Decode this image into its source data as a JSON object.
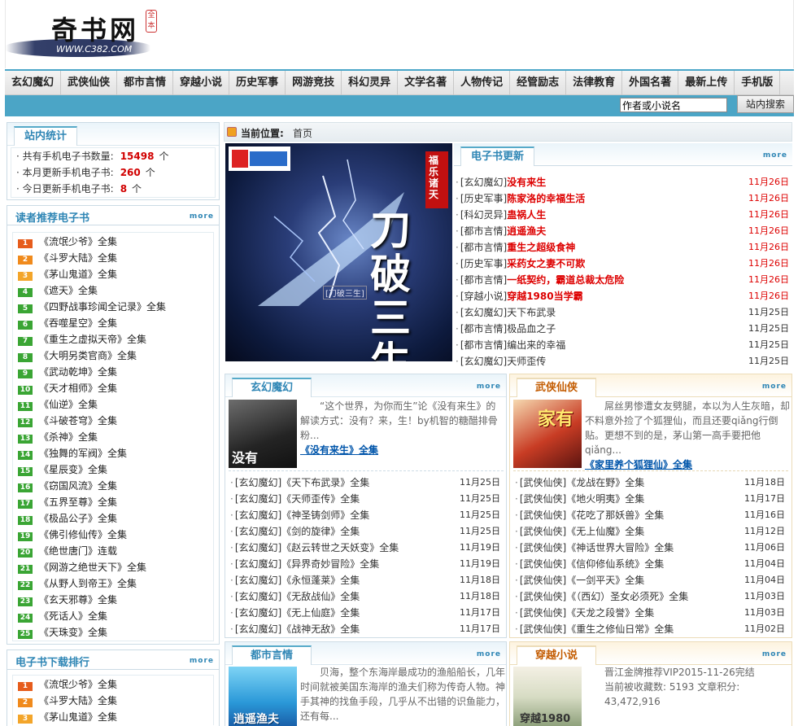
{
  "header": {
    "logo_text": "奇书网",
    "logo_url": "WWW.C382.COM",
    "logo_seal": "全本"
  },
  "nav": [
    "玄幻魔幻",
    "武侠仙侠",
    "都市言情",
    "穿越小说",
    "历史军事",
    "网游竞技",
    "科幻灵异",
    "文学名著",
    "人物传记",
    "经管励志",
    "法律教育",
    "外国名著",
    "最新上传",
    "手机版"
  ],
  "search": {
    "placeholder": "作者或小说名",
    "value": "作者或小说名",
    "button": "站内搜索"
  },
  "more_label": "more",
  "stats": {
    "title": "站内统计",
    "rows": [
      {
        "label": "共有手机电子书数量:",
        "value": "15498",
        "unit": "个"
      },
      {
        "label": "本月更新手机电子书:",
        "value": "260",
        "unit": "个"
      },
      {
        "label": "今日更新手机电子书:",
        "value": "8",
        "unit": "个"
      }
    ]
  },
  "reader_rank": {
    "title": "读者推荐电子书",
    "items": [
      {
        "n": "1",
        "t": "《流氓少爷》全集"
      },
      {
        "n": "2",
        "t": "《斗罗大陆》全集"
      },
      {
        "n": "3",
        "t": "《茅山鬼道》全集"
      },
      {
        "n": "4",
        "t": "《遮天》全集"
      },
      {
        "n": "5",
        "t": "《四野战事珍闻全记录》全集"
      },
      {
        "n": "6",
        "t": "《吞噬星空》全集"
      },
      {
        "n": "7",
        "t": "《重生之虚拟天帝》全集"
      },
      {
        "n": "8",
        "t": "《大明另类官商》全集"
      },
      {
        "n": "9",
        "t": "《武动乾坤》全集"
      },
      {
        "n": "10",
        "t": "《天才相师》全集"
      },
      {
        "n": "11",
        "t": "《仙逆》全集"
      },
      {
        "n": "12",
        "t": "《斗破苍穹》全集"
      },
      {
        "n": "13",
        "t": "《杀神》全集"
      },
      {
        "n": "14",
        "t": "《独舞的军阀》全集"
      },
      {
        "n": "15",
        "t": "《星辰变》全集"
      },
      {
        "n": "16",
        "t": "《窃国风流》全集"
      },
      {
        "n": "17",
        "t": "《五界至尊》全集"
      },
      {
        "n": "18",
        "t": "《极品公子》全集"
      },
      {
        "n": "19",
        "t": "《佛引修仙传》全集"
      },
      {
        "n": "20",
        "t": "《绝世唐门》连载"
      },
      {
        "n": "21",
        "t": "《网游之绝世天下》全集"
      },
      {
        "n": "22",
        "t": "《从野人到帝王》全集"
      },
      {
        "n": "23",
        "t": "《玄天邪尊》全集"
      },
      {
        "n": "24",
        "t": "《死话人》全集"
      },
      {
        "n": "25",
        "t": "《天珠变》全集"
      }
    ]
  },
  "download_rank": {
    "title": "电子书下载排行",
    "items": [
      {
        "n": "1",
        "t": "《流氓少爷》全集"
      },
      {
        "n": "2",
        "t": "《斗罗大陆》全集"
      },
      {
        "n": "3",
        "t": "《茅山鬼道》全集"
      }
    ]
  },
  "location": {
    "label": "当前位置:",
    "value": "首页"
  },
  "banner": {
    "title": "刀破三生",
    "top_tag": "福乐诸天",
    "author": "[刀破三生]"
  },
  "updates": {
    "title": "电子书更新",
    "items": [
      {
        "c": "[玄幻魔幻]",
        "t": "没有来生",
        "d": "11月26日",
        "hot": true
      },
      {
        "c": "[历史军事]",
        "t": "陈家洛的幸福生活",
        "d": "11月26日",
        "hot": true
      },
      {
        "c": "[科幻灵异]",
        "t": "蛊祸人生",
        "d": "11月26日",
        "hot": true
      },
      {
        "c": "[都市言情]",
        "t": "逍遥渔夫",
        "d": "11月26日",
        "hot": true
      },
      {
        "c": "[都市言情]",
        "t": "重生之超级食神",
        "d": "11月26日",
        "hot": true
      },
      {
        "c": "[历史军事]",
        "t": "采药女之妻不可欺",
        "d": "11月26日",
        "hot": true
      },
      {
        "c": "[都市言情]",
        "t": "一纸契约，霸道总裁太危险",
        "d": "11月26日",
        "hot": true
      },
      {
        "c": "[穿越小说]",
        "t": "穿越1980当学霸",
        "d": "11月26日",
        "hot": true
      },
      {
        "c": "[玄幻魔幻]",
        "t": "天下布武录",
        "d": "11月25日",
        "hot": false
      },
      {
        "c": "[都市言情]",
        "t": "极品血之子",
        "d": "11月25日",
        "hot": false
      },
      {
        "c": "[都市言情]",
        "t": "编出来的幸福",
        "d": "11月25日",
        "hot": false
      },
      {
        "c": "[玄幻魔幻]",
        "t": "天师歪传",
        "d": "11月25日",
        "hot": false
      }
    ]
  },
  "xuanhuan": {
    "title": "玄幻魔幻",
    "cover_text": "没有",
    "intro": "“这个世界，为你而生”论《没有来生》的解读方式：没有？来，生！by机智的糖醋排骨粉...",
    "link": "《没有来生》全集",
    "items": [
      {
        "c": "[玄幻魔幻]",
        "t": "《天下布武录》全集",
        "d": "11月25日"
      },
      {
        "c": "[玄幻魔幻]",
        "t": "《天师歪传》全集",
        "d": "11月25日"
      },
      {
        "c": "[玄幻魔幻]",
        "t": "《神圣铸剑师》全集",
        "d": "11月25日"
      },
      {
        "c": "[玄幻魔幻]",
        "t": "《剑的旋律》全集",
        "d": "11月25日"
      },
      {
        "c": "[玄幻魔幻]",
        "t": "《赵云转世之天妖变》全集",
        "d": "11月19日"
      },
      {
        "c": "[玄幻魔幻]",
        "t": "《异界奇妙冒险》全集",
        "d": "11月19日"
      },
      {
        "c": "[玄幻魔幻]",
        "t": "《永恒蓬莱》全集",
        "d": "11月18日"
      },
      {
        "c": "[玄幻魔幻]",
        "t": "《无敌战仙》全集",
        "d": "11月18日"
      },
      {
        "c": "[玄幻魔幻]",
        "t": "《无上仙庭》全集",
        "d": "11月17日"
      },
      {
        "c": "[玄幻魔幻]",
        "t": "《战神无敌》全集",
        "d": "11月17日"
      }
    ]
  },
  "wuxia": {
    "title": "武侠仙侠",
    "cover_text": "家有",
    "intro": "屌丝男惨遭女友劈腿，本以为人生灰暗，却不料意外捡了个狐狸仙，而且还要qiǎng行倒贴。更想不到的是，茅山第一高手要把他qiǎng...",
    "link": "《家里养个狐狸仙》全集",
    "items": [
      {
        "c": "[武侠仙侠]",
        "t": "《龙战在野》全集",
        "d": "11月18日"
      },
      {
        "c": "[武侠仙侠]",
        "t": "《地火明夷》全集",
        "d": "11月17日"
      },
      {
        "c": "[武侠仙侠]",
        "t": "《花吃了那妖兽》全集",
        "d": "11月16日"
      },
      {
        "c": "[武侠仙侠]",
        "t": "《无上仙魔》全集",
        "d": "11月12日"
      },
      {
        "c": "[武侠仙侠]",
        "t": "《神话世界大冒险》全集",
        "d": "11月06日"
      },
      {
        "c": "[武侠仙侠]",
        "t": "《信仰修仙系统》全集",
        "d": "11月04日"
      },
      {
        "c": "[武侠仙侠]",
        "t": "《一剑平天》全集",
        "d": "11月04日"
      },
      {
        "c": "[武侠仙侠]",
        "t": "《（西幻）圣女必须死》全集",
        "d": "11月03日"
      },
      {
        "c": "[武侠仙侠]",
        "t": "《天龙之段誉》全集",
        "d": "11月03日"
      },
      {
        "c": "[武侠仙侠]",
        "t": "《重生之修仙日常》全集",
        "d": "11月02日"
      }
    ]
  },
  "dushi": {
    "title": "都市言情",
    "cover_text": "逍遥渔夫",
    "intro": "贝海，整个东海岸最成功的渔船船长，几年时间就被美国东海岸的渔夫们称为传奇人物。神手其神的找鱼手段，几乎从不出错的识鱼能力，还有每..."
  },
  "chuanyue": {
    "title": "穿越小说",
    "cover_text": "穿越1980",
    "intro_line1": "晋江金牌推荐VIP2015-11-26完结",
    "intro_line2": "当前被收藏数: 5193 文章积分: 43,472,916"
  },
  "colors": {
    "accent": "#4ba5c6",
    "tab_text": "#2f86b5",
    "hot": "#d00000"
  }
}
